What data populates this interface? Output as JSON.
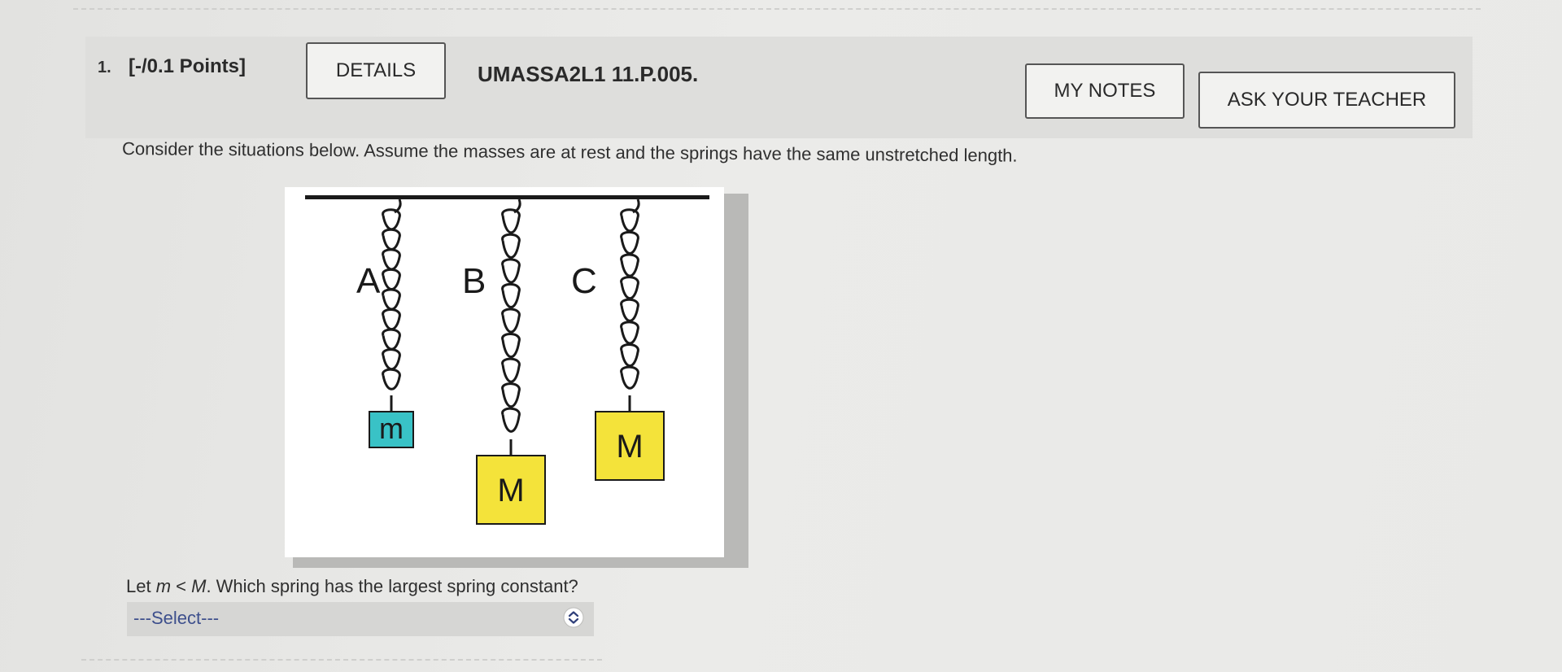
{
  "question": {
    "number": "1.",
    "points": "[-/0.1 Points]",
    "details_label": "DETAILS",
    "problem_id": "UMASSA2L1 11.P.005.",
    "my_notes_label": "MY NOTES",
    "ask_teacher_label": "ASK YOUR TEACHER"
  },
  "prompt": "Consider the situations below. Assume the masses are at rest and the springs have the same unstretched length.",
  "figure": {
    "springs": [
      {
        "label": "A",
        "mass_label": "m",
        "mass_color": "#39c2c6"
      },
      {
        "label": "B",
        "mass_label": "M",
        "mass_color": "#f4e33a"
      },
      {
        "label": "C",
        "mass_label": "M",
        "mass_color": "#f4e33a"
      }
    ]
  },
  "sub_question": {
    "prefix": "Let ",
    "var_m": "m",
    "lt": " < ",
    "var_M": "M",
    "suffix": ". Which spring has the largest spring constant?"
  },
  "select": {
    "value": "---Select---",
    "icon": "chevron-updown-icon"
  },
  "colors": {
    "select_text": "#3d4f8c",
    "border": "#555555"
  }
}
